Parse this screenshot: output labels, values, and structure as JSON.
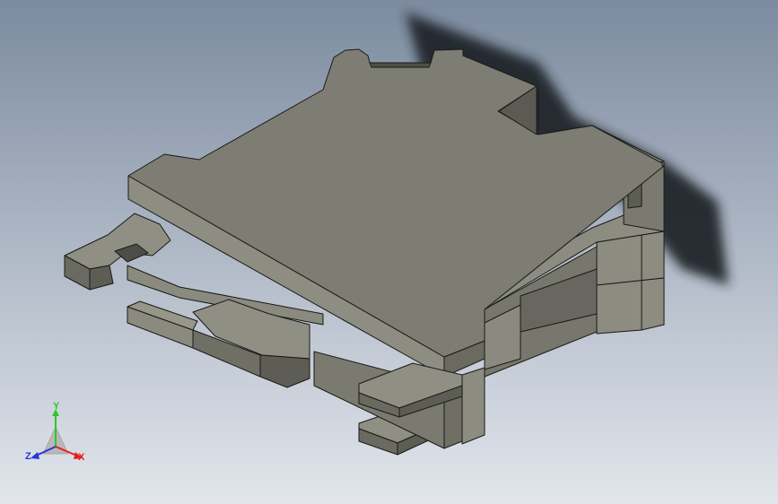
{
  "viewport": {
    "background_top": "#7c8ba0",
    "background_bottom": "#e2e6ec"
  },
  "model": {
    "name": "terminal-block",
    "colors": {
      "top": "#7d7d73",
      "side_light": "#8f8f84",
      "side_mid": "#727268",
      "side_dark": "#5d5d55",
      "edge": "#1a1a18",
      "shadow": "#1f2228"
    }
  },
  "triad": {
    "x_label": "X",
    "y_label": "Y",
    "z_label": "Z",
    "x_color": "#e8201a",
    "y_color": "#2ec52e",
    "z_color": "#2a36d8"
  }
}
